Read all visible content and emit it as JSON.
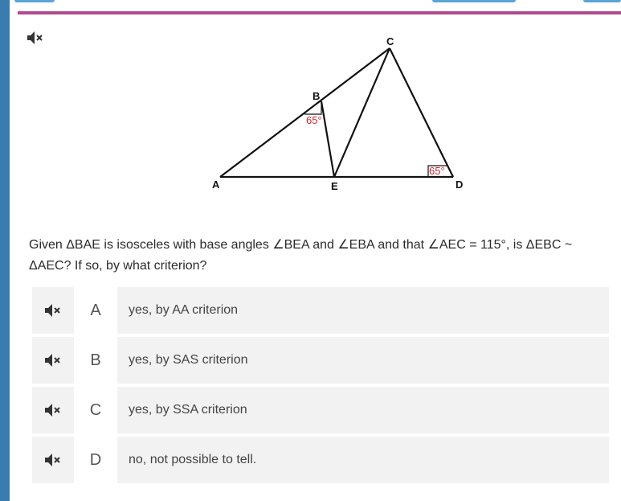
{
  "question": {
    "text": "Given ΔBAE is isosceles with base angles ∠BEA and ∠EBA and that ∠AEC = 115°, is ΔEBC ~ ΔAEC? If so, by what criterion?"
  },
  "figure": {
    "labels": {
      "A": "A",
      "B": "B",
      "C": "C",
      "D": "D",
      "E": "E"
    },
    "angle_b": "65°",
    "angle_d": "65°",
    "angle_color": "#d0262e"
  },
  "options": [
    {
      "letter": "A",
      "text": "yes, by AA criterion"
    },
    {
      "letter": "B",
      "text": "yes, by SAS criterion"
    },
    {
      "letter": "C",
      "text": "yes, by SSA criterion"
    },
    {
      "letter": "D",
      "text": "no, not possible to tell."
    }
  ],
  "colors": {
    "accent_bar": "#3a7bb0",
    "divider": "#b04a8e"
  },
  "icons": {
    "audio": "speaker-muted-icon"
  }
}
